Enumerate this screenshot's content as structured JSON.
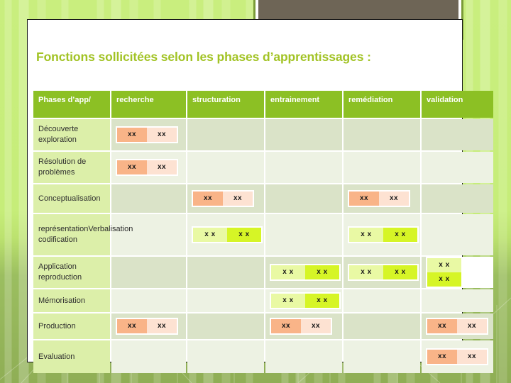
{
  "slide": {
    "title": "Fonctions sollicitées selon les phases d’apprentissages :",
    "decoration": {
      "picture_placeholder": "picture-placeholder",
      "frame_color": "#7A9B38",
      "image_color": "#6E6556"
    },
    "background_color": "#C9EE7E",
    "accent_color": "#8CC024"
  },
  "table": {
    "columns": [
      "Phases d’app/",
      "recherche",
      "structuration",
      "entrainement",
      "remédiation",
      "validation"
    ],
    "marker_orange": "xx",
    "marker_green": "x",
    "colors": {
      "header_bg": "#8CC024",
      "label_bg": "#DCEFA9",
      "row_odd_bg": "#DAE3C8",
      "row_even_bg": "#EDF2E3",
      "chip_orange_dark": "#F9B488",
      "chip_orange_light": "#FDE2D2",
      "chip_green_dark": "#D6F526",
      "chip_green_light": "#E9F9A4"
    },
    "rows": [
      {
        "label": "Découverte exploration",
        "cells": [
          {
            "type": "orange",
            "marks": [
              "xx",
              "xx"
            ]
          },
          {
            "type": "empty",
            "marks": []
          },
          {
            "type": "empty",
            "marks": []
          },
          {
            "type": "empty",
            "marks": []
          },
          {
            "type": "empty",
            "marks": []
          }
        ]
      },
      {
        "label": "Résolution de problèmes",
        "cells": [
          {
            "type": "orange",
            "marks": [
              "xx",
              "xx"
            ]
          },
          {
            "type": "empty",
            "marks": []
          },
          {
            "type": "empty",
            "marks": []
          },
          {
            "type": "empty",
            "marks": []
          },
          {
            "type": "empty",
            "marks": []
          }
        ]
      },
      {
        "label": "Conceptualisation",
        "cells": [
          {
            "type": "empty",
            "marks": []
          },
          {
            "type": "orange",
            "marks": [
              "xx",
              "xx"
            ]
          },
          {
            "type": "empty",
            "marks": []
          },
          {
            "type": "orange",
            "marks": [
              "xx",
              "xx"
            ]
          },
          {
            "type": "empty",
            "marks": []
          }
        ]
      },
      {
        "label": "représentationVerbalisation codification",
        "cells": [
          {
            "type": "empty",
            "marks": []
          },
          {
            "type": "green",
            "marks": [
              "x  x",
              "x  x"
            ]
          },
          {
            "type": "empty",
            "marks": []
          },
          {
            "type": "green",
            "marks": [
              "x  x",
              "x  x"
            ]
          },
          {
            "type": "empty",
            "marks": []
          }
        ]
      },
      {
        "label": "Application reproduction",
        "cells": [
          {
            "type": "empty",
            "marks": []
          },
          {
            "type": "empty",
            "marks": []
          },
          {
            "type": "green",
            "marks": [
              "x  x",
              "x  x"
            ]
          },
          {
            "type": "green",
            "marks": [
              "x  x",
              "x  x"
            ]
          },
          {
            "type": "green",
            "marks": [
              "x  x",
              "x  x"
            ]
          }
        ]
      },
      {
        "label": "Mémorisation",
        "cells": [
          {
            "type": "empty",
            "marks": []
          },
          {
            "type": "empty",
            "marks": []
          },
          {
            "type": "green",
            "marks": [
              "x  x",
              "x  x"
            ]
          },
          {
            "type": "empty",
            "marks": []
          },
          {
            "type": "empty",
            "marks": []
          }
        ]
      },
      {
        "label": "Production",
        "cells": [
          {
            "type": "orange",
            "marks": [
              "xx",
              "xx"
            ]
          },
          {
            "type": "empty",
            "marks": []
          },
          {
            "type": "orange",
            "marks": [
              "xx",
              "xx"
            ]
          },
          {
            "type": "empty",
            "marks": []
          },
          {
            "type": "orange",
            "marks": [
              "xx",
              "xx"
            ]
          }
        ]
      },
      {
        "label": "Evaluation",
        "cells": [
          {
            "type": "empty",
            "marks": []
          },
          {
            "type": "empty",
            "marks": []
          },
          {
            "type": "empty",
            "marks": []
          },
          {
            "type": "empty",
            "marks": []
          },
          {
            "type": "orange",
            "marks": [
              "xx",
              "xx"
            ]
          }
        ]
      }
    ]
  }
}
